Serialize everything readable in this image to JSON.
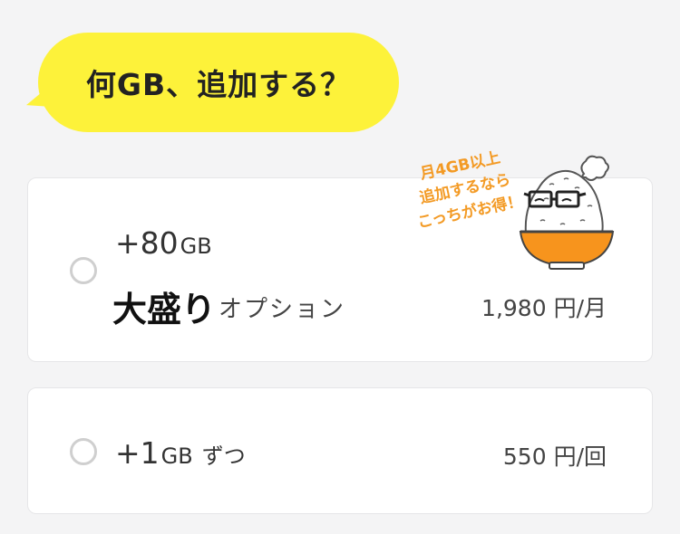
{
  "question": {
    "text": "何GB、追加する？"
  },
  "options": [
    {
      "amount": "+80",
      "unit": "GB",
      "name": "大盛り",
      "suffix": "オプション",
      "price": "1,980 円/月",
      "promo": {
        "line1": "月4GB以上",
        "line2": "追加するなら",
        "line3": "こっちがお得！"
      },
      "selected": false
    },
    {
      "amount": "+1",
      "unit": "GB",
      "suffix": "ずつ",
      "price": "550 円/回",
      "selected": false
    }
  ],
  "colors": {
    "bubble": "#fdf23a",
    "promo": "#f39a24",
    "bowl": "#f7941d",
    "background": "#f4f4f5"
  },
  "icons": {
    "mascot": "rice-bowl-with-glasses-icon",
    "radio": "radio-circle-icon"
  }
}
